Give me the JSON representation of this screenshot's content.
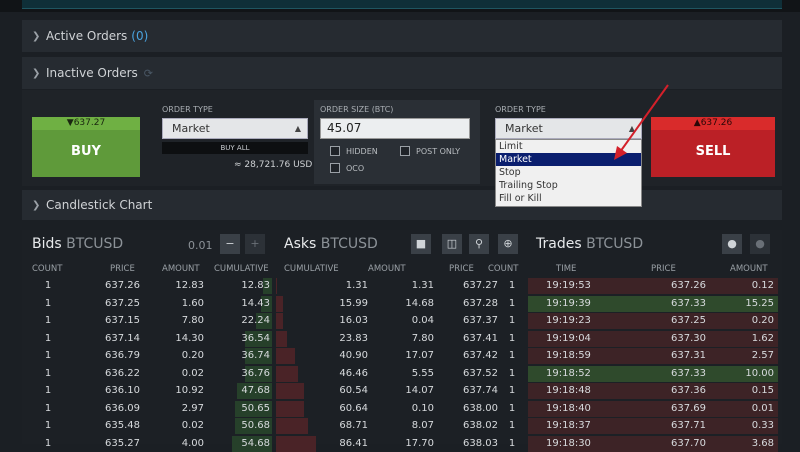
{
  "sections": {
    "active_label": "Active Orders",
    "active_count": "(0)",
    "inactive_label": "Inactive Orders",
    "chart_label": "Candlestick Chart"
  },
  "trade": {
    "buy_price": "▼637.27",
    "buy_label": "BUY",
    "order_type_label": "ORDER TYPE",
    "order_type_value": "Market",
    "buy_all": "BUY ALL",
    "usd_value": "≈ 28,721.76 USD",
    "size_label": "ORDER SIZE (BTC)",
    "size_value": "45.07",
    "hidden": "HIDDEN",
    "post_only": "POST ONLY",
    "oco": "OCO",
    "order_type2_label": "ORDER TYPE",
    "order_type2_value": "Market",
    "options": [
      "Limit",
      "Market",
      "Stop",
      "Trailing Stop",
      "Fill or Kill"
    ],
    "selected_option": "Market",
    "sell_price": "▲637.26",
    "sell_label": "SELL"
  },
  "bids": {
    "title": "Bids",
    "symbol": "BTCUSD",
    "precision": "0.01",
    "headers": [
      "COUNT",
      "PRICE",
      "AMOUNT",
      "CUMULATIVE"
    ],
    "rows": [
      [
        "1",
        "637.26",
        "12.83",
        "12.83"
      ],
      [
        "1",
        "637.25",
        "1.60",
        "14.43"
      ],
      [
        "1",
        "637.15",
        "7.80",
        "22.24"
      ],
      [
        "1",
        "637.14",
        "14.30",
        "36.54"
      ],
      [
        "1",
        "636.79",
        "0.20",
        "36.74"
      ],
      [
        "1",
        "636.22",
        "0.02",
        "36.76"
      ],
      [
        "1",
        "636.10",
        "10.92",
        "47.68"
      ],
      [
        "1",
        "636.09",
        "2.97",
        "50.65"
      ],
      [
        "1",
        "635.48",
        "0.02",
        "50.68"
      ],
      [
        "1",
        "635.27",
        "4.00",
        "54.68"
      ]
    ]
  },
  "asks": {
    "title": "Asks",
    "symbol": "BTCUSD",
    "headers": [
      "CUMULATIVE",
      "AMOUNT",
      "PRICE",
      "COUNT"
    ],
    "rows": [
      [
        "1.31",
        "1.31",
        "637.27",
        "1"
      ],
      [
        "15.99",
        "14.68",
        "637.28",
        "1"
      ],
      [
        "16.03",
        "0.04",
        "637.37",
        "1"
      ],
      [
        "23.83",
        "7.80",
        "637.41",
        "1"
      ],
      [
        "40.90",
        "17.07",
        "637.42",
        "1"
      ],
      [
        "46.46",
        "5.55",
        "637.52",
        "1"
      ],
      [
        "60.54",
        "14.07",
        "637.74",
        "1"
      ],
      [
        "60.64",
        "0.10",
        "638.00",
        "1"
      ],
      [
        "68.71",
        "8.07",
        "638.02",
        "1"
      ],
      [
        "86.41",
        "17.70",
        "638.03",
        "1"
      ]
    ]
  },
  "trades": {
    "title": "Trades",
    "symbol": "BTCUSD",
    "headers": [
      "TIME",
      "PRICE",
      "AMOUNT"
    ],
    "rows": [
      [
        "19:19:53",
        "637.26",
        "0.12",
        "sell"
      ],
      [
        "19:19:39",
        "637.33",
        "15.25",
        "buy"
      ],
      [
        "19:19:23",
        "637.25",
        "0.20",
        "sell"
      ],
      [
        "19:19:04",
        "637.30",
        "1.62",
        "sell"
      ],
      [
        "19:18:59",
        "637.31",
        "2.57",
        "sell"
      ],
      [
        "19:18:52",
        "637.33",
        "10.00",
        "buy"
      ],
      [
        "19:18:48",
        "637.36",
        "0.15",
        "sell"
      ],
      [
        "19:18:40",
        "637.69",
        "0.01",
        "sell"
      ],
      [
        "19:18:37",
        "637.71",
        "0.33",
        "sell"
      ],
      [
        "19:18:30",
        "637.70",
        "3.68",
        "sell"
      ]
    ]
  },
  "colors": {
    "buy": "#5f9a3a",
    "sell": "#bb2026",
    "accent": "#4aa3df",
    "bid_bar": "#26402a",
    "ask_bar": "#4a2327",
    "trade_buy": "#2f4a2c",
    "trade_sell": "#3d2326"
  }
}
